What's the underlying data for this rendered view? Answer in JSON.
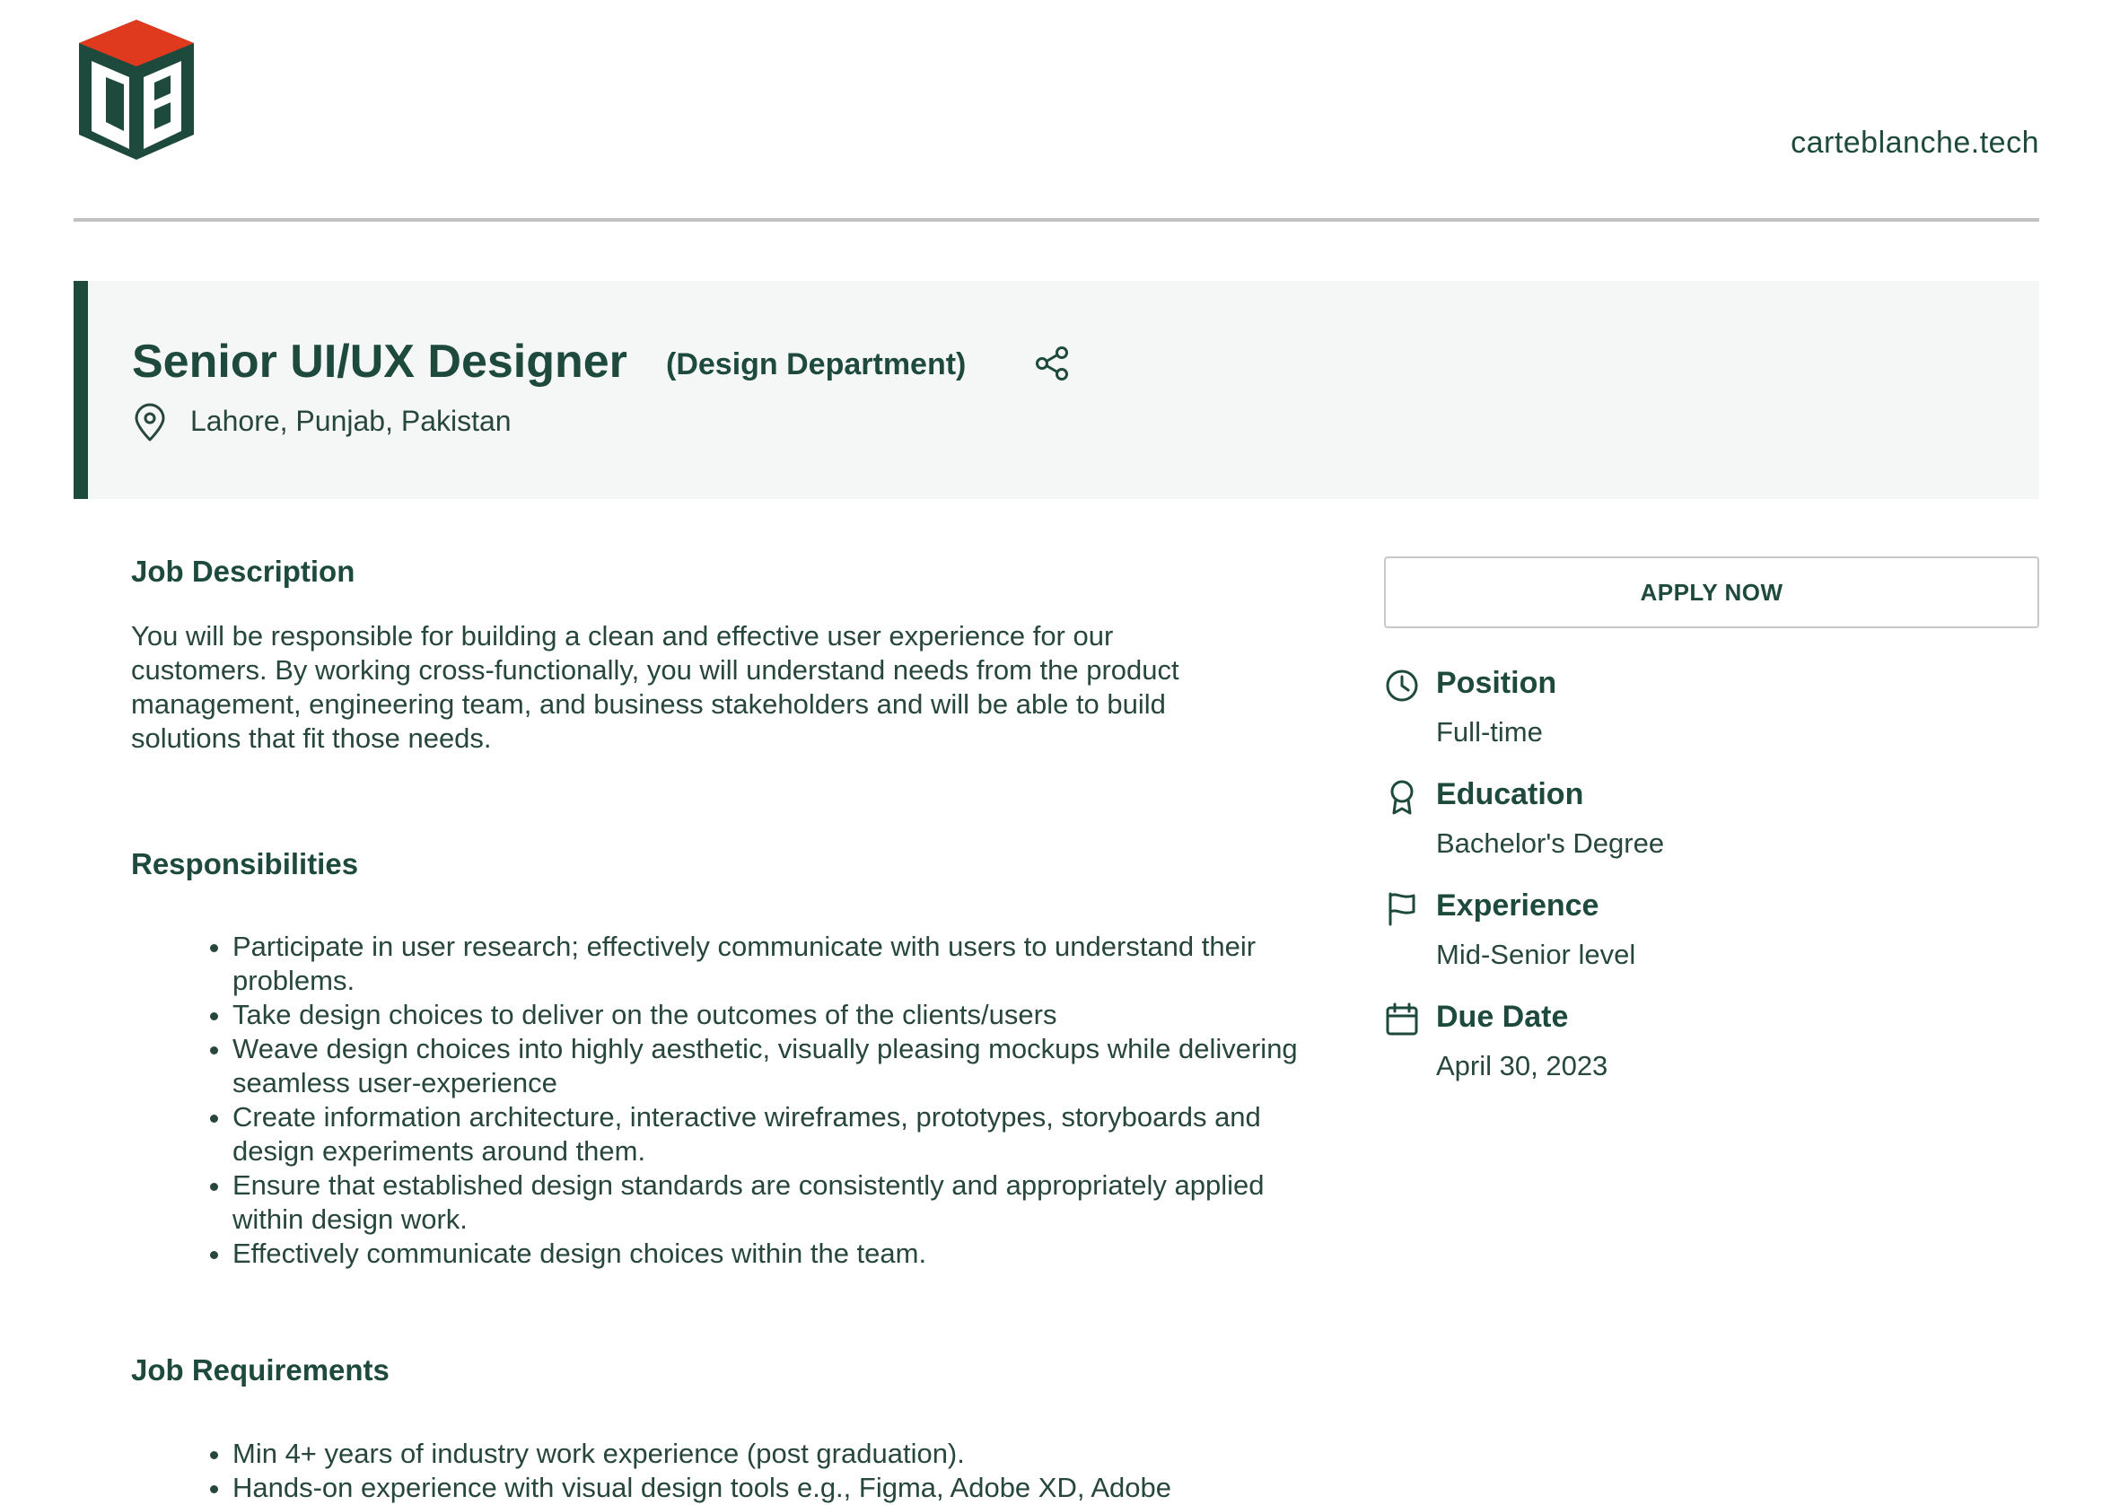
{
  "brand": {
    "logo_letters": "CB",
    "website": "carteblanche.tech",
    "colors": {
      "primary": "#1e4a3d",
      "accent": "#e03a1e",
      "banner_bg": "#f5f6f6"
    }
  },
  "job": {
    "title": "Senior UI/UX Designer",
    "department": "(Design Department)",
    "location": "Lahore, Punjab, Pakistan"
  },
  "description": {
    "heading": "Job Description",
    "text": "You will be responsible for building a clean and effective user experience for our customers. By working cross-functionally, you will understand needs from the product management, engineering team, and business stakeholders and will be able to build solutions that fit those needs."
  },
  "responsibilities": {
    "heading": "Responsibilities",
    "items": [
      "Participate in user research; effectively communicate with users to understand their problems.",
      "Take design choices to deliver on the outcomes of the clients/users",
      "Weave design choices into highly aesthetic, visually pleasing mockups while delivering seamless user-experience",
      "Create information architecture, interactive wireframes, prototypes, storyboards and design experiments around them.",
      "Ensure that established design standards are consistently and appropriately applied within design work.",
      "Effectively communicate design choices within the team."
    ]
  },
  "requirements": {
    "heading": "Job Requirements",
    "items": [
      "Min 4+ years of industry work experience (post graduation).",
      "Hands-on experience with visual design tools e.g., Figma, Adobe XD, Adobe"
    ]
  },
  "sidebar": {
    "apply_label": "APPLY NOW",
    "details": [
      {
        "icon": "clock-icon",
        "label": "Position",
        "value": "Full-time"
      },
      {
        "icon": "award-icon",
        "label": "Education",
        "value": "Bachelor's Degree"
      },
      {
        "icon": "flag-icon",
        "label": "Experience",
        "value": "Mid-Senior level"
      },
      {
        "icon": "calendar-icon",
        "label": "Due Date",
        "value": "April 30, 2023"
      }
    ]
  }
}
